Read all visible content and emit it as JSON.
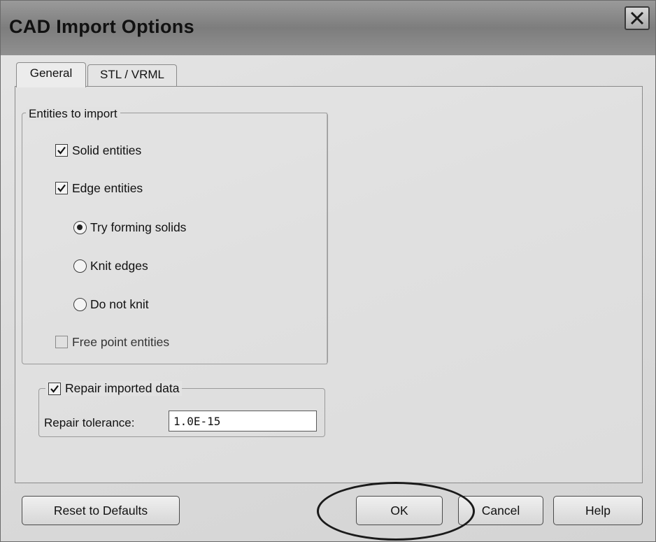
{
  "window": {
    "title": "CAD Import Options"
  },
  "tabs": [
    {
      "label": "General",
      "active": true
    },
    {
      "label": "STL / VRML",
      "active": false
    }
  ],
  "entities_group": {
    "legend": "Entities to import",
    "solid": {
      "label": "Solid entities",
      "checked": true
    },
    "edge": {
      "label": "Edge entities",
      "checked": true
    },
    "edge_options": [
      {
        "label": "Try forming solids",
        "selected": true
      },
      {
        "label": "Knit edges",
        "selected": false
      },
      {
        "label": "Do not knit",
        "selected": false
      }
    ],
    "free_point": {
      "label": "Free point entities",
      "checked": false
    }
  },
  "repair_group": {
    "label": "Repair imported data",
    "checked": true,
    "tolerance_label": "Repair tolerance:",
    "tolerance_value": "1.0E-15"
  },
  "buttons": {
    "reset": "Reset to Defaults",
    "ok": "OK",
    "cancel": "Cancel",
    "help": "Help"
  },
  "icons": {
    "close": "close-icon",
    "check": "checkmark-icon"
  },
  "colors": {
    "title_bar": "#7d7d7d",
    "dialog_bg": "#dcdcdc",
    "highlight_ellipse": "#1a1a1a"
  }
}
